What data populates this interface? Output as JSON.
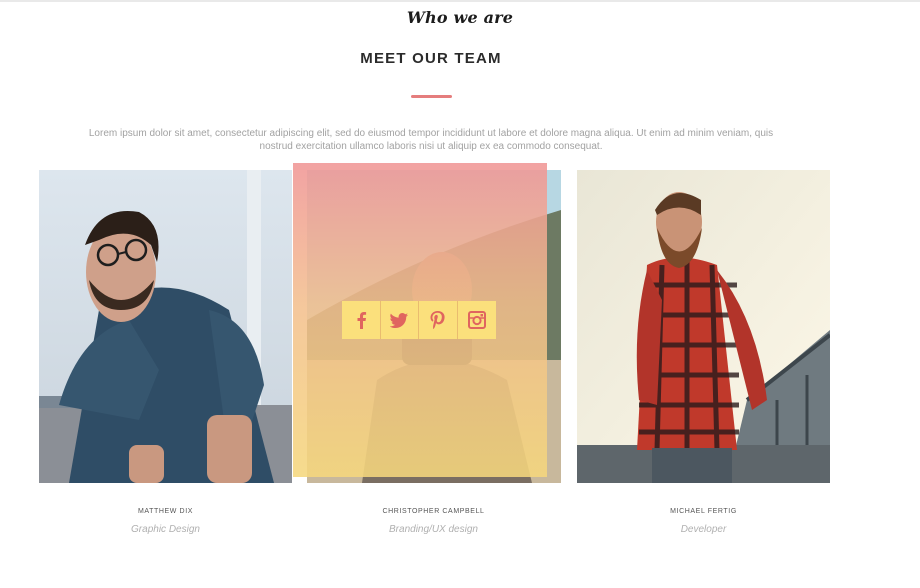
{
  "section": {
    "eyebrow": "Who we are",
    "title": "MEET OUR TEAM",
    "intro": "Lorem ipsum dolor sit amet, consectetur adipiscing elit, sed do eiusmod tempor incididunt ut labore et dolore magna aliqua. Ut enim ad minim veniam, quis nostrud exercitation ullamco laboris nisi ut aliquip ex ea commodo consequat.",
    "accent_color": "#e57d7d"
  },
  "team": [
    {
      "name": "MATTHEW DIX",
      "role": "Graphic Design"
    },
    {
      "name": "CHRISTOPHER CAMPBELL",
      "role": "Branding/UX design"
    },
    {
      "name": "MICHAEL FERTIG",
      "role": "Developer"
    }
  ],
  "social": {
    "icons": [
      "facebook-icon",
      "twitter-icon",
      "pinterest-icon",
      "instagram-icon"
    ],
    "button_color": "#fbe07c",
    "icon_color": "#e0655f"
  },
  "overlay": {
    "gradient_top": "#f09696",
    "gradient_bottom": "#f5d77d"
  }
}
